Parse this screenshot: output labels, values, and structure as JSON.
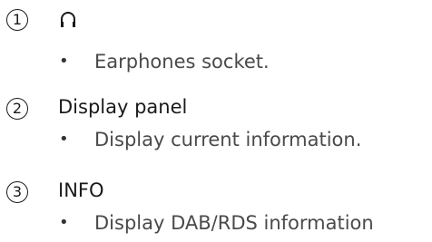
{
  "items": [
    {
      "number": "1",
      "icon": "headphones-icon",
      "title": "",
      "bullet": "•",
      "description": "Earphones socket."
    },
    {
      "number": "2",
      "title": "Display panel",
      "bullet": "•",
      "description": "Display current information."
    },
    {
      "number": "3",
      "title": "INFO",
      "bullet": "•",
      "description": "Display DAB/RDS information"
    }
  ]
}
